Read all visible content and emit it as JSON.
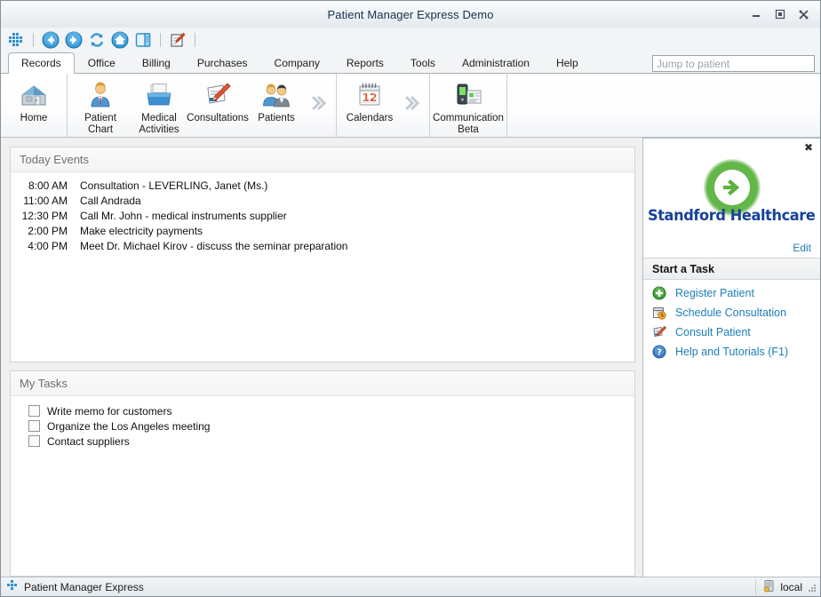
{
  "window": {
    "title": "Patient Manager Express Demo",
    "controls": [
      {
        "name": "minimize",
        "glyph": "minimize-icon"
      },
      {
        "name": "maximize",
        "glyph": "maximize-icon"
      },
      {
        "name": "close",
        "glyph": "close-icon"
      }
    ]
  },
  "toolbar": {
    "items": [
      {
        "name": "app-menu-icon",
        "title": "Application Menu"
      },
      {
        "name": "back-icon",
        "title": "Back"
      },
      {
        "name": "forward-icon",
        "title": "Forward"
      },
      {
        "name": "refresh-icon",
        "title": "Refresh"
      },
      {
        "name": "home-icon",
        "title": "Home"
      },
      {
        "name": "panel-icon",
        "title": "Navigation Panel"
      },
      {
        "name": "notes-icon",
        "title": "Notes"
      }
    ]
  },
  "tabs": [
    {
      "label": "Records",
      "active": true
    },
    {
      "label": "Office",
      "active": false
    },
    {
      "label": "Billing",
      "active": false
    },
    {
      "label": "Purchases",
      "active": false
    },
    {
      "label": "Company",
      "active": false
    },
    {
      "label": "Reports",
      "active": false
    },
    {
      "label": "Tools",
      "active": false
    },
    {
      "label": "Administration",
      "active": false
    },
    {
      "label": "Help",
      "active": false
    }
  ],
  "search": {
    "placeholder": "Jump to patient",
    "value": ""
  },
  "ribbon": {
    "groups": [
      {
        "buttons": [
          {
            "label": "Home",
            "icon": "house-icon"
          }
        ],
        "chevron": false
      },
      {
        "buttons": [
          {
            "label": "Patient Chart",
            "icon": "patient-chart-icon"
          },
          {
            "label": "Medical Activities",
            "icon": "medical-activities-icon"
          },
          {
            "label": "Consultations",
            "icon": "consultations-icon"
          },
          {
            "label": "Patients",
            "icon": "patients-icon"
          }
        ],
        "chevron": true
      },
      {
        "buttons": [
          {
            "label": "Calendars",
            "icon": "calendar-icon"
          }
        ],
        "chevron": true
      },
      {
        "buttons": [
          {
            "label": "Communication Beta",
            "icon": "communication-icon"
          }
        ],
        "chevron": false
      }
    ]
  },
  "today_events": {
    "title": "Today Events",
    "rows": [
      {
        "time": "8:00 AM",
        "description": "Consultation - LEVERLING, Janet (Ms.)"
      },
      {
        "time": "11:00 AM",
        "description": "Call Andrada"
      },
      {
        "time": "12:30 PM",
        "description": "Call Mr. John - medical instruments supplier"
      },
      {
        "time": "2:00 PM",
        "description": "Make electricity payments"
      },
      {
        "time": "4:00 PM",
        "description": "Meet Dr. Michael Kirov - discuss the seminar preparation"
      }
    ]
  },
  "my_tasks": {
    "title": "My Tasks",
    "rows": [
      {
        "label": "Write memo for customers",
        "checked": false
      },
      {
        "label": "Organize the Los Angeles meeting",
        "checked": false
      },
      {
        "label": "Contact suppliers",
        "checked": false
      }
    ]
  },
  "sidebar": {
    "logo_text": "Standford Healthcare",
    "edit_label": "Edit",
    "close_label": "✖",
    "start_task_title": "Start a Task",
    "links": [
      {
        "label": "Register Patient",
        "icon": "plus-circle-icon"
      },
      {
        "label": "Schedule Consultation",
        "icon": "schedule-icon"
      },
      {
        "label": "Consult Patient",
        "icon": "consult-icon"
      },
      {
        "label": "Help and Tutorials  (F1)",
        "icon": "help-icon"
      }
    ]
  },
  "statusbar": {
    "app_label": "Patient Manager Express",
    "connection_label": "local"
  },
  "colors": {
    "link": "#1c7fb5",
    "logo_blue": "#17419b",
    "logo_green": "#63b64a",
    "accent_blue": "#2f8fd0"
  }
}
